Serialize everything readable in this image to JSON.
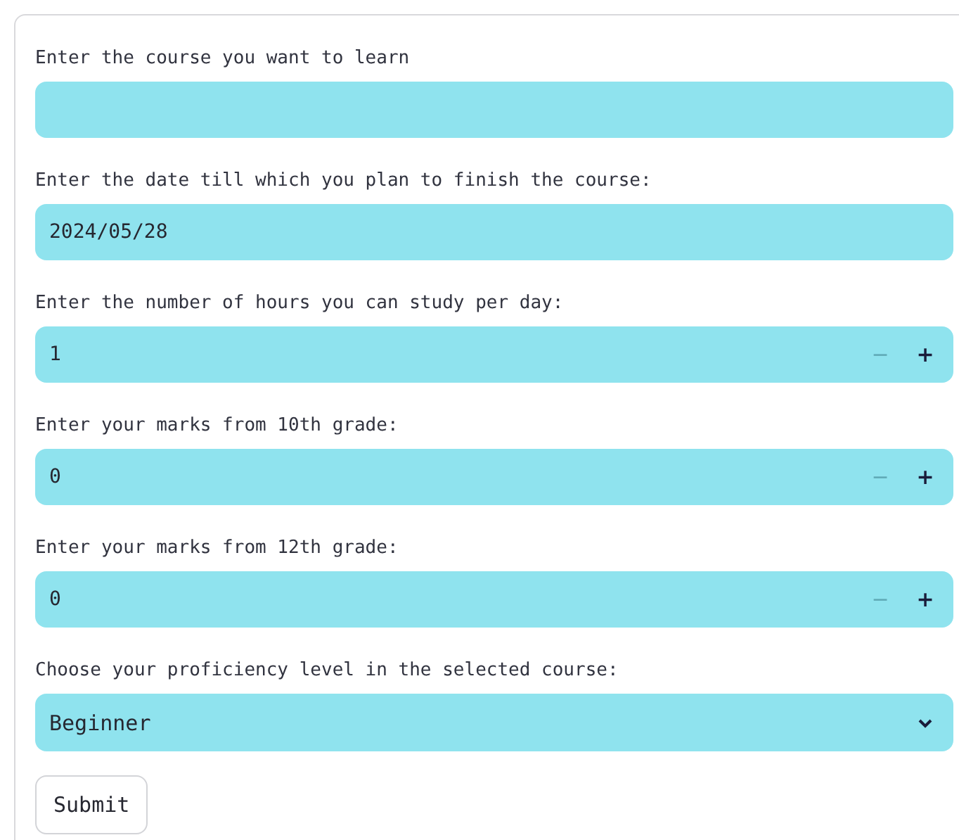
{
  "fields": [
    {
      "kind": "text",
      "label": "Enter the course you want to learn"
    },
    {
      "kind": "date",
      "label": "Enter the date till which you plan to finish the course:",
      "value": "2024/05/28"
    },
    {
      "kind": "number",
      "label": "Enter the number of hours you can study per day:",
      "value": "1",
      "decrement": {
        "label": "−",
        "disabled": true
      },
      "increment": {
        "label": "+",
        "disabled": false
      }
    },
    {
      "kind": "number",
      "label": "Enter your marks from 10th grade:",
      "value": "0",
      "decrement": {
        "label": "−",
        "disabled": true
      },
      "increment": {
        "label": "+",
        "disabled": false
      }
    },
    {
      "kind": "number",
      "label": "Enter your marks from 12th grade:",
      "value": "0",
      "decrement": {
        "label": "−",
        "disabled": true
      },
      "increment": {
        "label": "+",
        "disabled": false
      }
    },
    {
      "kind": "select",
      "label": "Choose your proficiency level in the selected course:",
      "value": "Beginner"
    }
  ],
  "submit": {
    "label": "Submit"
  }
}
